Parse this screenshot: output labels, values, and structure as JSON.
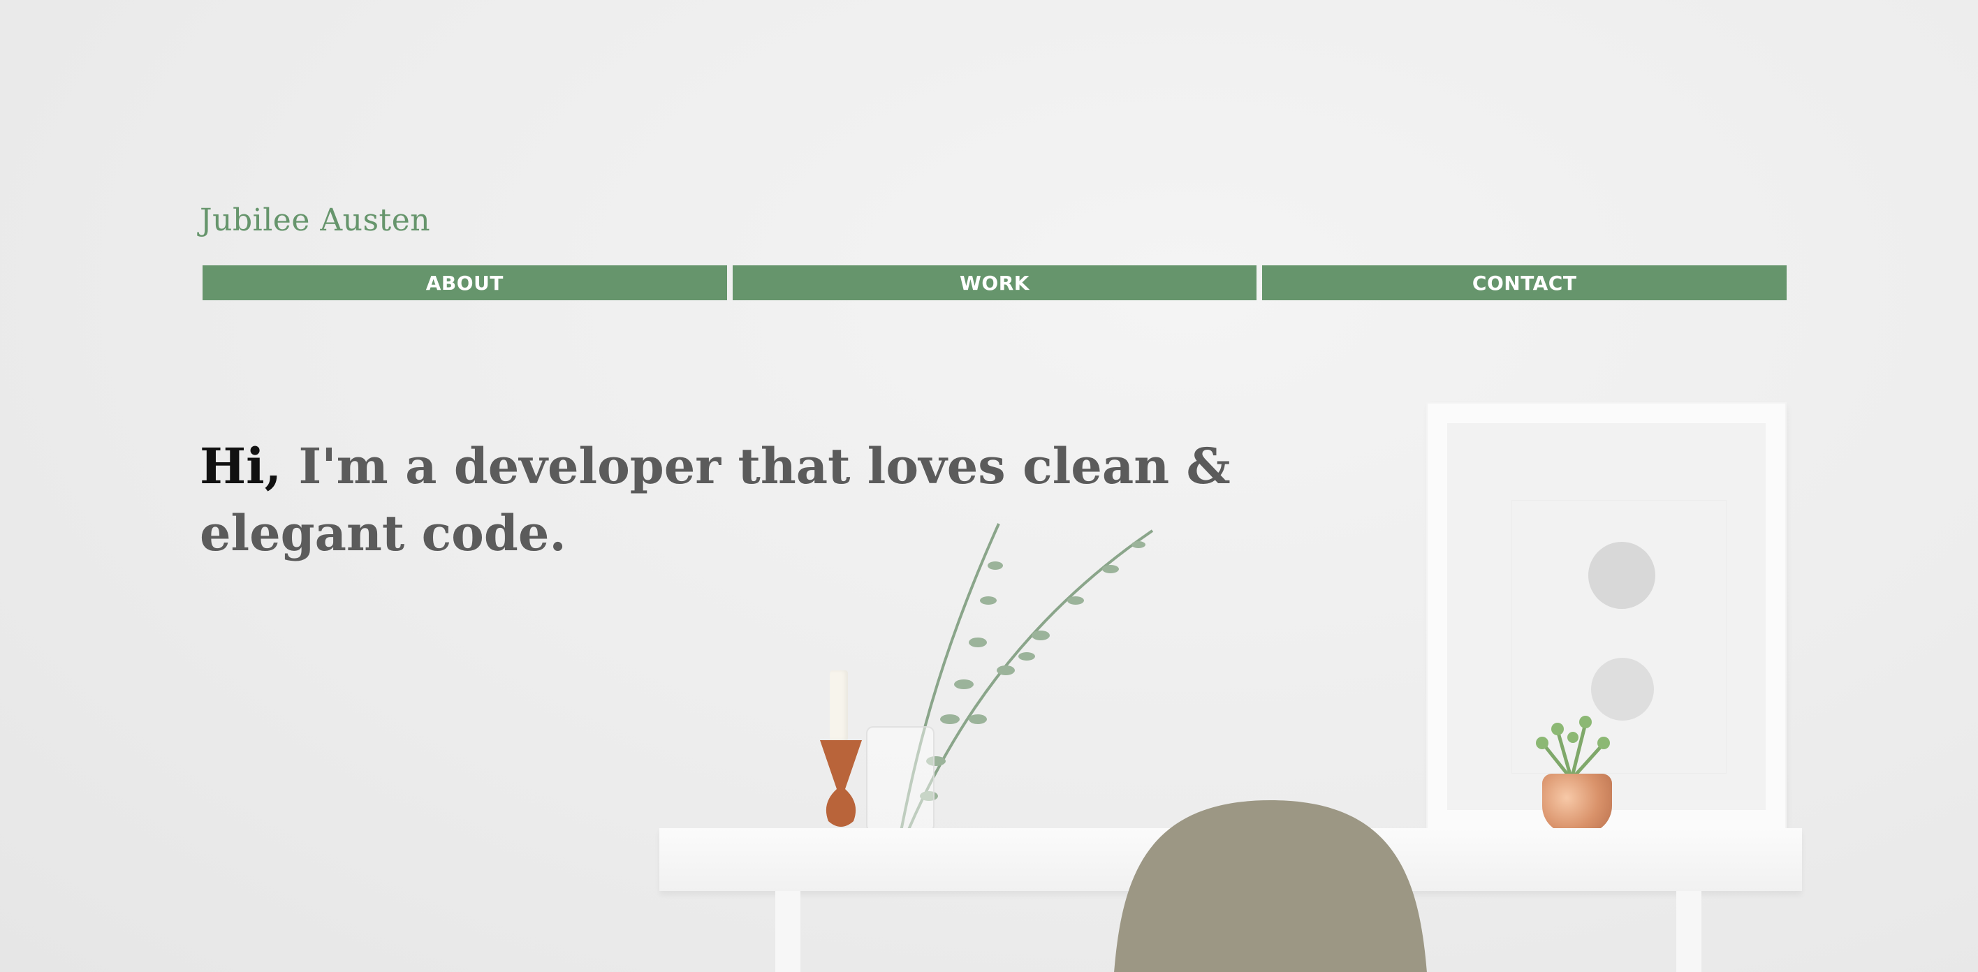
{
  "site": {
    "brand": "Jubilee Austen"
  },
  "nav": {
    "items": [
      {
        "label": "ABOUT"
      },
      {
        "label": "WORK"
      },
      {
        "label": "CONTACT"
      }
    ]
  },
  "hero": {
    "headline_hi": "Hi,",
    "headline_rest": " I'm a developer that loves clean & elegant code."
  },
  "colors": {
    "accent": "#66956c",
    "text": "#5b5b5b",
    "heading_emphasis": "#111111",
    "background": "#ececec"
  },
  "icons": {
    "background_image": "minimal-desk-scene"
  }
}
